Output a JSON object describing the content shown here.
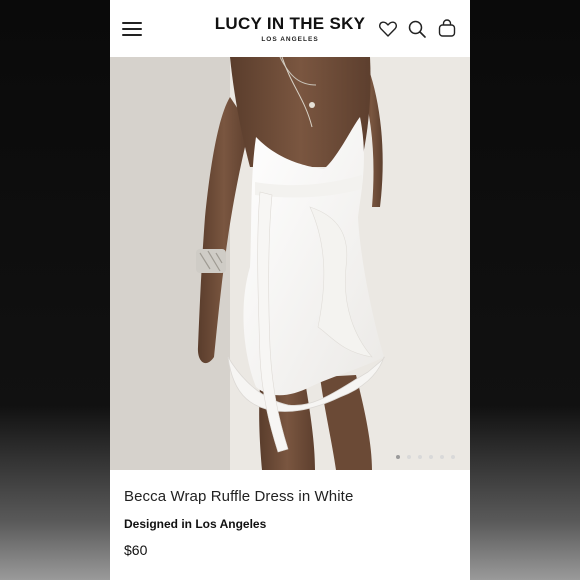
{
  "header": {
    "brand_name": "LUCY IN THE SKY",
    "brand_subtitle": "LOS ANGELES",
    "icons": [
      "menu-icon",
      "heart-icon",
      "search-icon",
      "bag-icon"
    ]
  },
  "gallery": {
    "total_images": 6,
    "active_index": 0
  },
  "product": {
    "title": "Becca Wrap Ruffle Dress in White",
    "origin": "Designed in Los Angeles",
    "price": "$60"
  },
  "colors": {
    "text": "#111111",
    "background": "#ffffff",
    "dot_inactive": "#d9d9d9",
    "dot_active": "#9a9a9a"
  }
}
